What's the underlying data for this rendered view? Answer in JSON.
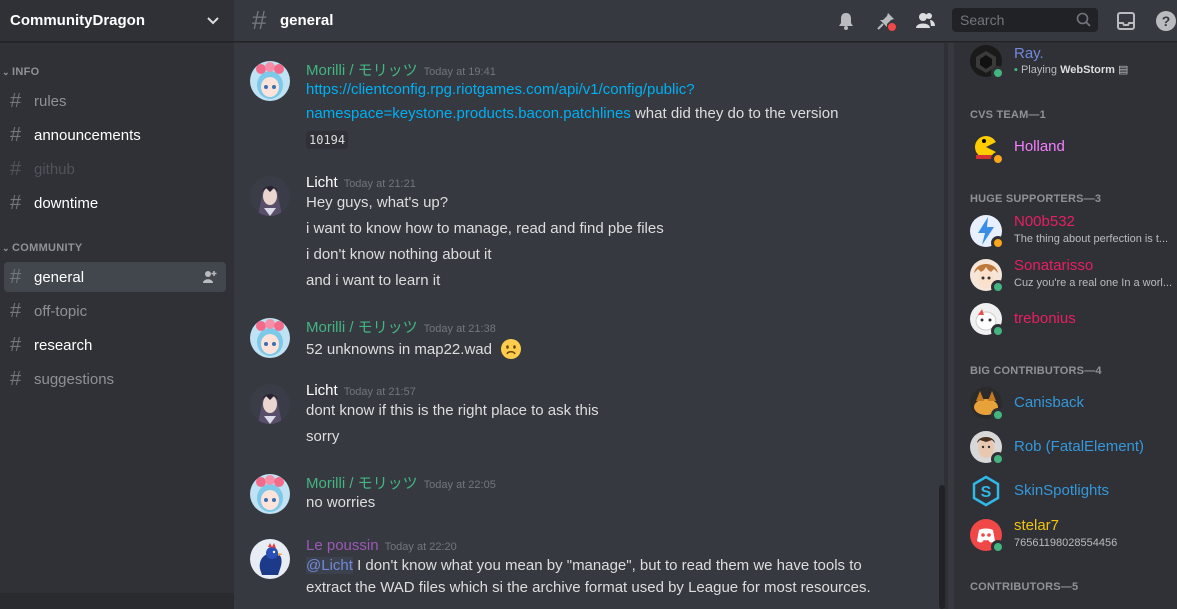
{
  "guild": {
    "name": "CommunityDragon"
  },
  "sidebar": {
    "categories": [
      {
        "label": "INFO"
      },
      {
        "label": "COMMUNITY"
      }
    ],
    "channels": [
      {
        "name": "rules"
      },
      {
        "name": "announcements"
      },
      {
        "name": "github"
      },
      {
        "name": "downtime"
      },
      {
        "name": "general"
      },
      {
        "name": "off-topic"
      },
      {
        "name": "research"
      },
      {
        "name": "suggestions"
      }
    ]
  },
  "topbar": {
    "channel_name": "general",
    "search_placeholder": "Search"
  },
  "messages": [
    {
      "author": "Morilli / モリッツ",
      "author_color": "#43b581",
      "timestamp": "Today at 19:41",
      "link": "https://clientconfig.rpg.riotgames.com/api/v1/config/public?",
      "link_cont": "namespace=keystone.products.bacon.patchlines",
      "text_after": " what did they do to the version",
      "code": "10194"
    },
    {
      "author": "Licht",
      "author_color": "#ffffff",
      "timestamp": "Today at 21:21",
      "lines": [
        "Hey guys, what's up?",
        "i want to know how to manage, read and find pbe files",
        "i don't know nothing about it",
        "and i want to learn it"
      ]
    },
    {
      "author": "Morilli / モリッツ",
      "author_color": "#43b581",
      "timestamp": "Today at 21:38",
      "lines": [
        "52 unknowns in map22.wad"
      ]
    },
    {
      "author": "Licht",
      "author_color": "#ffffff",
      "timestamp": "Today at 21:57",
      "lines": [
        "dont know if this is the right place to ask this",
        "sorry"
      ]
    },
    {
      "author": "Morilli / モリッツ",
      "author_color": "#43b581",
      "timestamp": "Today at 22:05",
      "lines": [
        "no worries"
      ]
    },
    {
      "author": "Le poussin",
      "author_color": "#9b59b6",
      "timestamp": "Today at 22:20",
      "mention": "@Licht",
      "text1": " I don't know what you mean by \"manage\", but to read them we have tools to",
      "text2": "extract the WAD files which si the archive format used by League for most resources."
    }
  ],
  "members": {
    "top_member": {
      "name": "Ray.",
      "activity_prefix": "Playing",
      "activity": "WebStorm",
      "color": "#7289da"
    },
    "groups": [
      {
        "title": "CVS TEAM—1",
        "members": [
          {
            "name": "Holland",
            "color": "#f47fff",
            "sub": ""
          }
        ]
      },
      {
        "title": "HUGE SUPPORTERS—3",
        "members": [
          {
            "name": "N00b532",
            "color": "#e91e63",
            "sub": "The thing about perfection is t..."
          },
          {
            "name": "Sonatarisso",
            "color": "#e91e63",
            "sub": "Cuz you're a real one In a worl..."
          },
          {
            "name": "trebonius",
            "color": "#e91e63",
            "sub": ""
          }
        ]
      },
      {
        "title": "BIG CONTRIBUTORS—4",
        "members": [
          {
            "name": "Canisback",
            "color": "#3498db",
            "sub": ""
          },
          {
            "name": "Rob (FatalElement)",
            "color": "#3498db",
            "sub": ""
          },
          {
            "name": "SkinSpotlights",
            "color": "#3498db",
            "sub": ""
          },
          {
            "name": "stelar7",
            "color": "#f1c40f",
            "sub": "76561198028554456"
          }
        ]
      },
      {
        "title": "CONTRIBUTORS—5",
        "members": []
      }
    ]
  },
  "colors": {
    "online": "#43b581",
    "idle": "#faa61a",
    "dnd": "#f04747"
  }
}
